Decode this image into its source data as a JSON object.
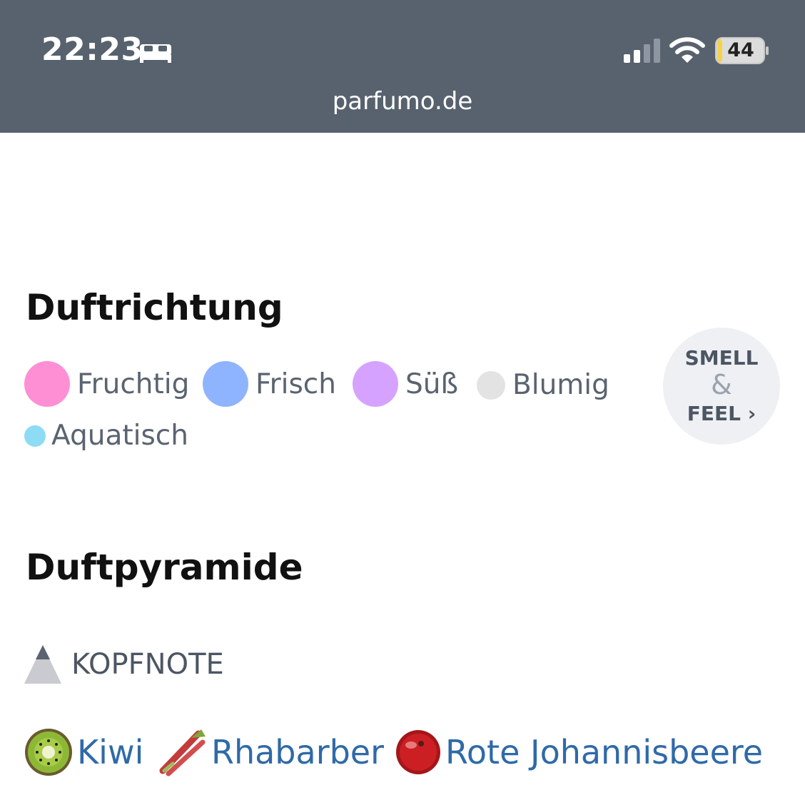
{
  "status_bar": {
    "time": "22:23",
    "battery": "44",
    "url": "parfumo.de",
    "icons": [
      "bed-icon",
      "cellular-signal-icon",
      "wifi-icon",
      "battery-charging-icon"
    ]
  },
  "duftrichtung": {
    "title": "Duftrichtung",
    "accords": [
      {
        "label": "Fruchtig",
        "color": "#ff8fd4",
        "size": "large"
      },
      {
        "label": "Frisch",
        "color": "#8fb4ff",
        "size": "large"
      },
      {
        "label": "Süß",
        "color": "#d6a2ff",
        "size": "large"
      },
      {
        "label": "Blumig",
        "color": "#e3e3e3",
        "size": "medium"
      },
      {
        "label": "Aquatisch",
        "color": "#8ddcf3",
        "size": "small"
      }
    ],
    "smell_feel": {
      "line1": "SMELL",
      "line2": "&",
      "line3": "FEEL",
      "chevron": "›"
    }
  },
  "duftpyramide": {
    "title": "Duftpyramide",
    "kopfnote": {
      "label": "KOPFNOTE",
      "icon": "pyramid-top-icon",
      "notes": [
        {
          "label": "Kiwi",
          "icon": "kiwi-icon"
        },
        {
          "label": "Rhabarber",
          "icon": "rhubarb-icon"
        },
        {
          "label": "Rote Johannisbeere",
          "icon": "redcurrant-icon"
        }
      ]
    }
  },
  "colors": {
    "status_bar_bg": "#57626e",
    "link": "#2f6aa8",
    "text_muted": "#5a6370"
  }
}
